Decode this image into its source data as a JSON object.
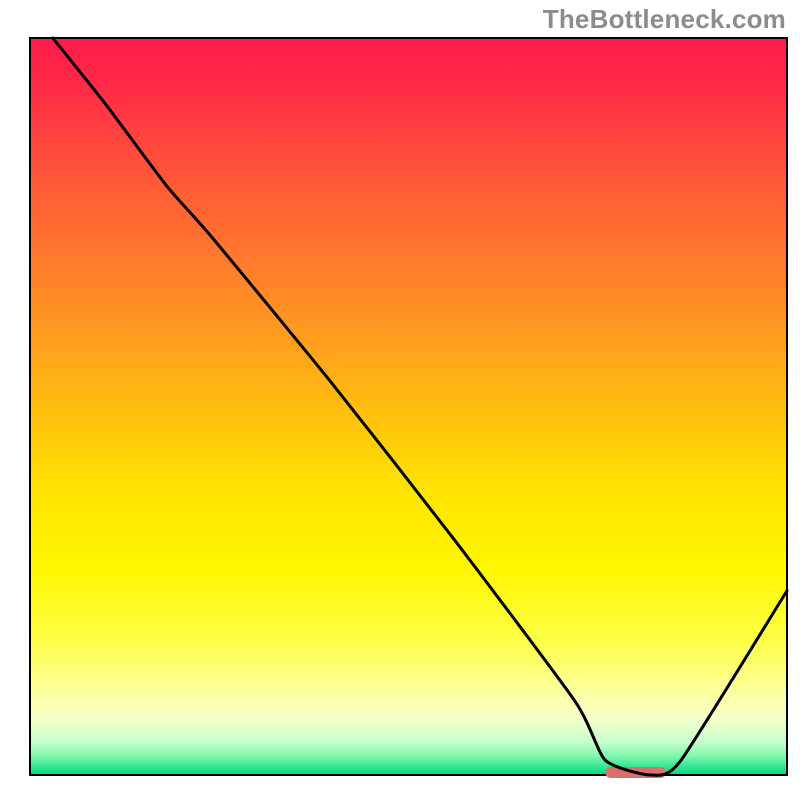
{
  "watermark": "TheBottleneck.com",
  "chart_data": {
    "type": "line",
    "title": "",
    "xlabel": "",
    "ylabel": "",
    "xlim": [
      0,
      100
    ],
    "ylim": [
      0,
      100
    ],
    "grid": false,
    "legend": false,
    "background_gradient": {
      "stops": [
        {
          "offset": 0.0,
          "color": "#ff1b4b"
        },
        {
          "offset": 0.06,
          "color": "#ff2847"
        },
        {
          "offset": 0.2,
          "color": "#ff5a37"
        },
        {
          "offset": 0.35,
          "color": "#ff8a27"
        },
        {
          "offset": 0.5,
          "color": "#ffbd10"
        },
        {
          "offset": 0.62,
          "color": "#ffe500"
        },
        {
          "offset": 0.72,
          "color": "#fff700"
        },
        {
          "offset": 0.82,
          "color": "#fdff4a"
        },
        {
          "offset": 0.88,
          "color": "#fdff96"
        },
        {
          "offset": 0.92,
          "color": "#f8ffc8"
        },
        {
          "offset": 0.955,
          "color": "#c8ffcc"
        },
        {
          "offset": 0.975,
          "color": "#7cf7ad"
        },
        {
          "offset": 0.99,
          "color": "#2de58f"
        },
        {
          "offset": 1.0,
          "color": "#00d880"
        }
      ]
    },
    "curve": {
      "description": "Bottleneck curve; y is value (100 at top, 0 at bottom), x is normalized component scale.",
      "x": [
        3,
        10,
        18,
        24,
        40,
        56,
        72,
        76,
        82,
        86,
        100
      ],
      "y": [
        100,
        91,
        80,
        73,
        53,
        32,
        10,
        2,
        0,
        2,
        25
      ]
    },
    "marker": {
      "description": "Highlighted optimal zone on x-axis",
      "x_start": 76,
      "x_end": 84,
      "y": 0,
      "color": "#d8706d"
    }
  }
}
